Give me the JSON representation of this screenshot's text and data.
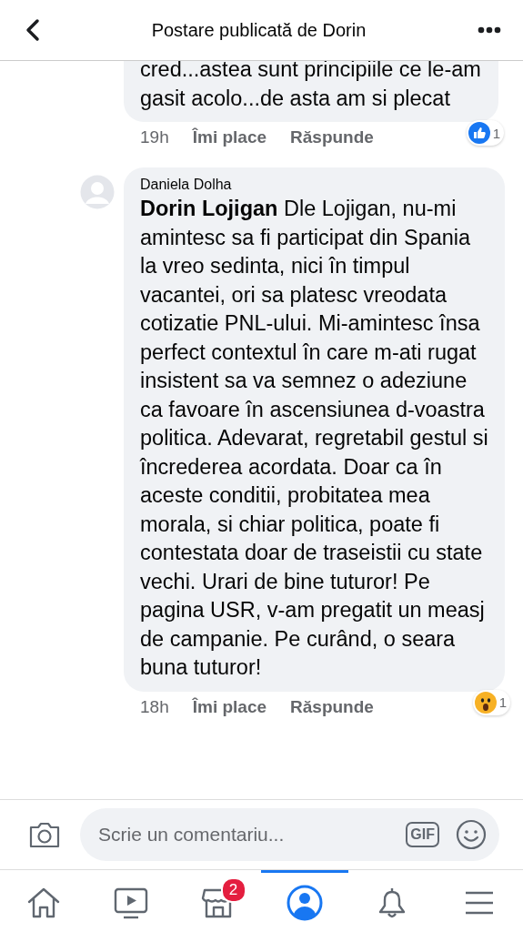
{
  "header": {
    "title": "Postare publicată de Dorin"
  },
  "comments": [
    {
      "text": "cred...astea sunt principiile ce le-am gasit acolo...de asta am si plecat",
      "time": "19h",
      "like": "Îmi place",
      "reply": "Răspunde",
      "reaction": {
        "kind": "like",
        "count": "1"
      }
    },
    {
      "author": "Daniela Dolha",
      "mention": "Dorin Lojigan",
      "text": "Dle Lojigan, nu-mi amintesc sa fi participat din Spania la vreo sedinta, nici în timpul vacantei, ori sa platesc vreodata cotizatie PNL-ului. Mi-amintesc însa perfect contextul în care m-ati rugat insistent sa va semnez o adeziune ca favoare în ascensiunea d-voastra politica. Adevarat, regretabil gestul si încrederea acordata. Doar ca în aceste conditii, probitatea mea morala, si chiar politica, poate fi contestata doar de traseistii cu state vechi. Urari de bine tuturor! Pe pagina USR, v-am pregatit un measj de campanie. Pe curând, o seara buna tuturor!",
      "time": "18h",
      "like": "Îmi place",
      "reply": "Răspunde",
      "reaction": {
        "kind": "wow",
        "count": "1"
      }
    }
  ],
  "composer": {
    "placeholder": "Scrie un comentariu...",
    "gif": "GIF"
  },
  "nav": [
    {
      "kind": "home",
      "selected": false
    },
    {
      "kind": "video",
      "selected": false
    },
    {
      "kind": "market",
      "selected": false,
      "badge": "2"
    },
    {
      "kind": "profile",
      "selected": true
    },
    {
      "kind": "bell",
      "selected": false
    },
    {
      "kind": "menu",
      "selected": false
    }
  ]
}
